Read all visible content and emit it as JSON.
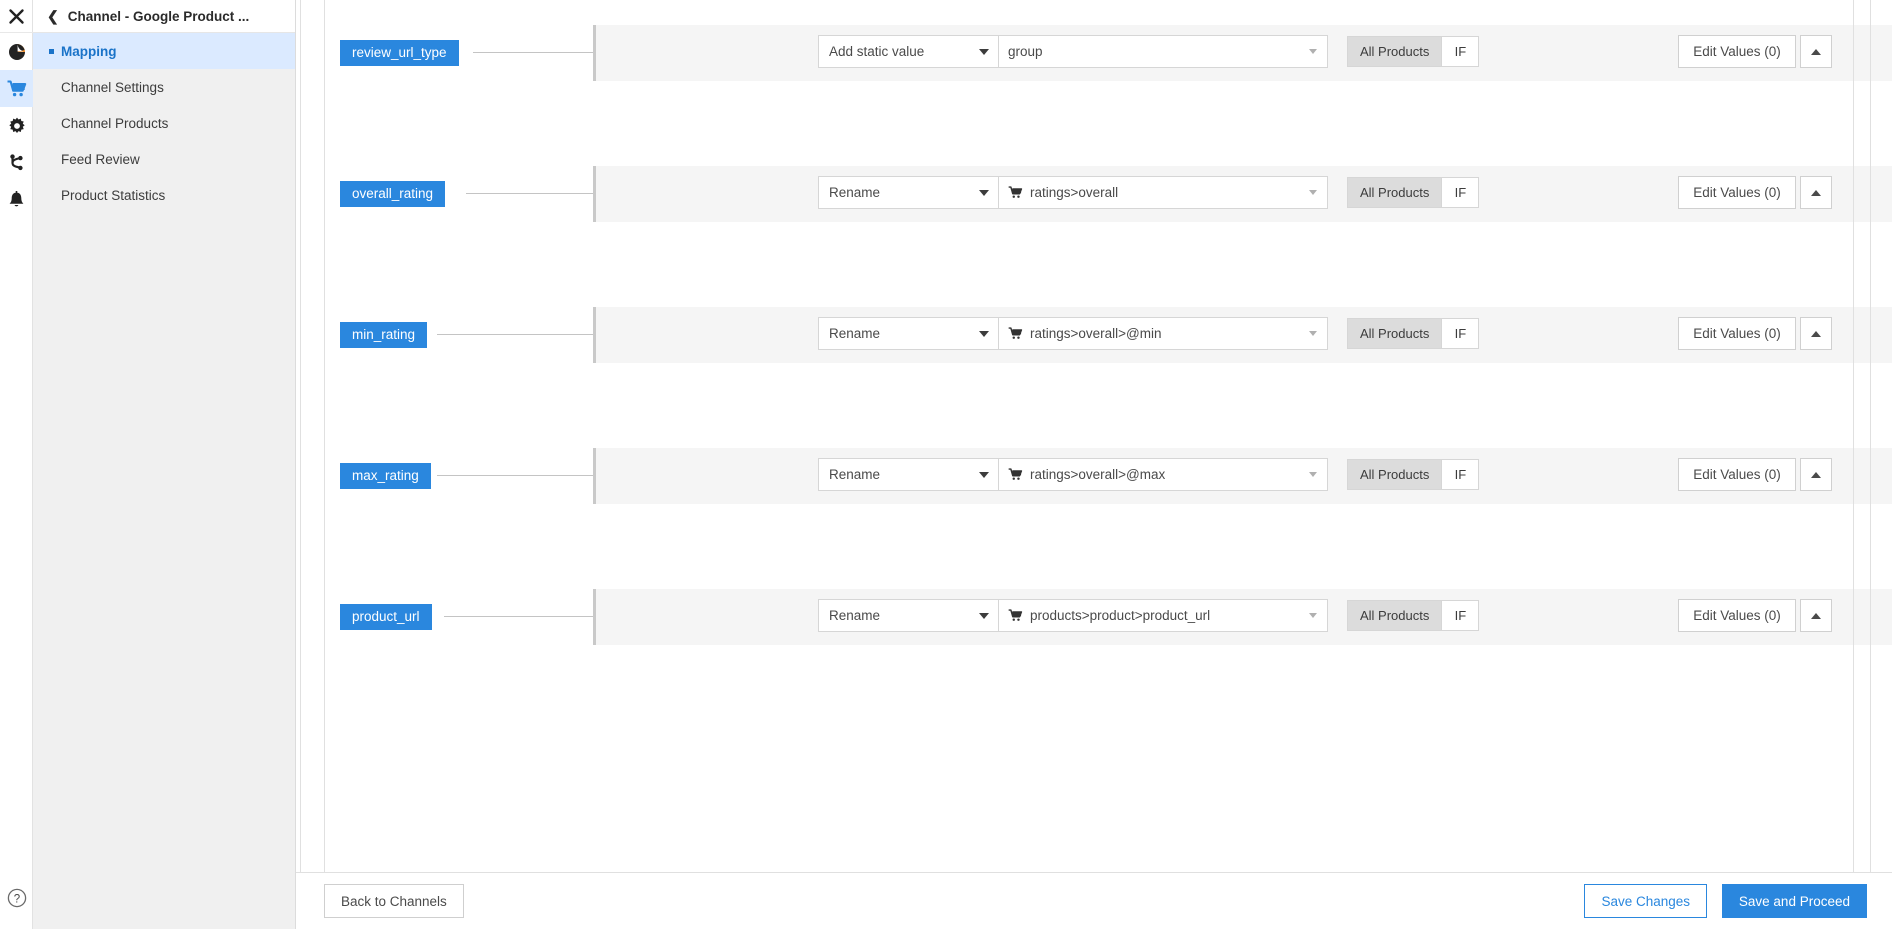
{
  "rail": {
    "items": [
      {
        "name": "close-icon",
        "label": "Close"
      },
      {
        "name": "analytics-icon",
        "label": "Analytics"
      },
      {
        "name": "cart-icon",
        "label": "Channels"
      },
      {
        "name": "gear-icon",
        "label": "Settings"
      },
      {
        "name": "branch-icon",
        "label": "Connections"
      },
      {
        "name": "bell-icon",
        "label": "Notifications"
      }
    ],
    "help_label": "Help"
  },
  "sidebar": {
    "title": "Channel - Google Product ...",
    "back_chevron": "‹",
    "items": [
      {
        "label": "Mapping",
        "active": true
      },
      {
        "label": "Channel Settings",
        "active": false
      },
      {
        "label": "Channel Products",
        "active": false
      },
      {
        "label": "Feed Review",
        "active": false
      },
      {
        "label": "Product Statistics",
        "active": false
      }
    ]
  },
  "mapping": {
    "segment_all_label": "All Products",
    "segment_if_label": "IF",
    "edit_values_label": "Edit Values (0)",
    "rows": [
      {
        "field": "review_url_type",
        "action": "Add static value",
        "source": "group",
        "source_has_cart": false,
        "segment_selected": "All Products",
        "edit_values": "Edit Values (0)"
      },
      {
        "field": "overall_rating",
        "action": "Rename",
        "source": "ratings>overall",
        "source_has_cart": true,
        "segment_selected": "All Products",
        "edit_values": "Edit Values (0)"
      },
      {
        "field": "min_rating",
        "action": "Rename",
        "source": "ratings>overall>@min",
        "source_has_cart": true,
        "segment_selected": "All Products",
        "edit_values": "Edit Values (0)"
      },
      {
        "field": "max_rating",
        "action": "Rename",
        "source": "ratings>overall>@max",
        "source_has_cart": true,
        "segment_selected": "All Products",
        "edit_values": "Edit Values (0)"
      },
      {
        "field": "product_url",
        "action": "Rename",
        "source": "products>product>product_url",
        "source_has_cart": true,
        "segment_selected": "All Products",
        "edit_values": "Edit Values (0)"
      }
    ]
  },
  "footer": {
    "back_label": "Back to Channels",
    "save_label": "Save Changes",
    "proceed_label": "Save and Proceed"
  },
  "colors": {
    "accent": "#2a87de",
    "pill": "#2a87de",
    "nav_active_bg": "#dbeaff",
    "band_bg": "#f5f5f5",
    "sidebar_bg": "#f0f0f0"
  }
}
